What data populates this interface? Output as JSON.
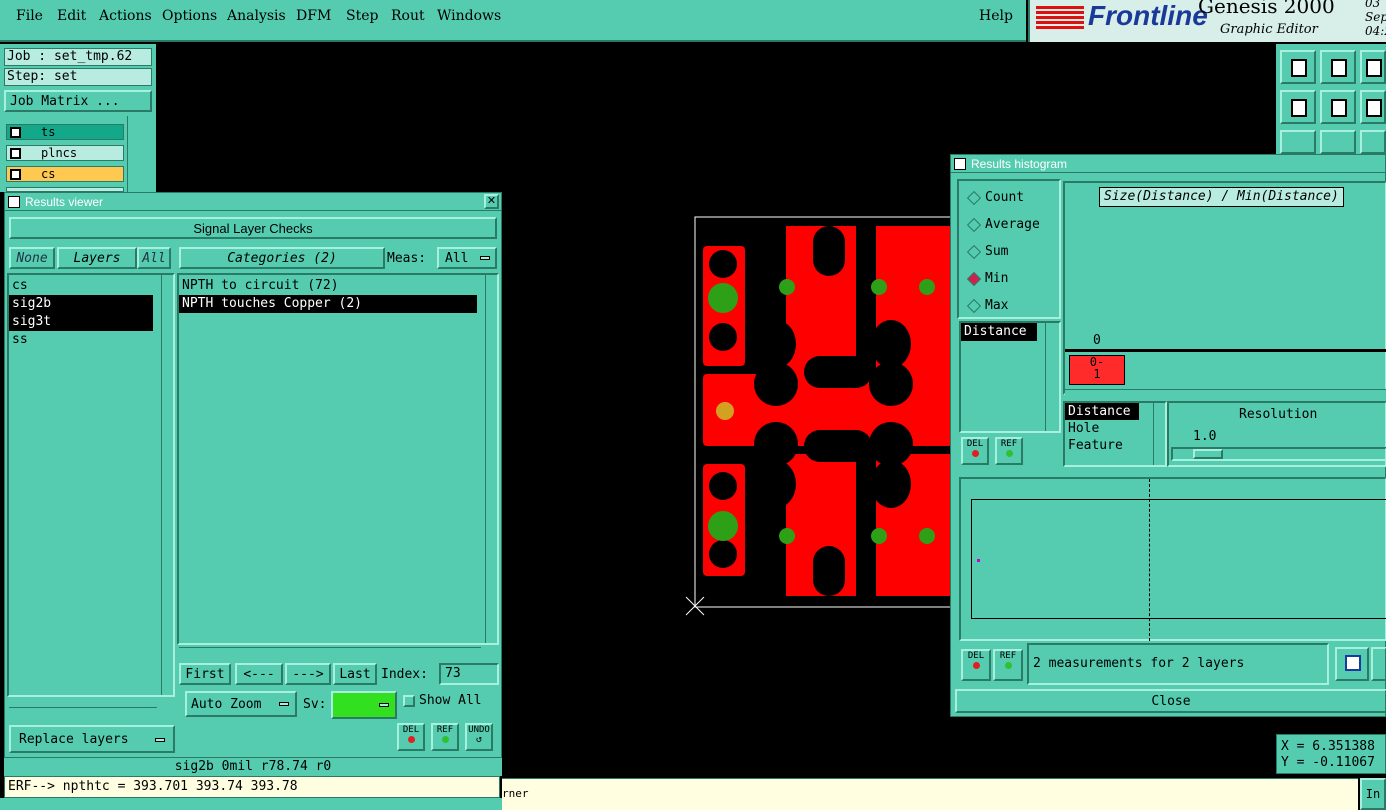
{
  "menu": {
    "items": [
      "File",
      "Edit",
      "Actions",
      "Options",
      "Analysis",
      "DFM",
      "Step",
      "Rout",
      "Windows"
    ],
    "help": "Help"
  },
  "brand": {
    "logo": "Frontline",
    "product": "Genesis 2000",
    "subtitle": "Graphic Editor",
    "date_fragment": "03 Sep",
    "time_fragment": "04:2"
  },
  "job": {
    "job_label": "Job : set_tmp.62",
    "step_label": "Step: set",
    "matrix_button": "Job Matrix ..."
  },
  "layers": [
    {
      "name": "ts",
      "color": "#13a88a"
    },
    {
      "name": "plncs",
      "color": "#b8ece0"
    },
    {
      "name": "cs",
      "color": "#ffc850"
    },
    {
      "name": "",
      "color": "#b8ece0"
    }
  ],
  "results_viewer": {
    "title": "Results viewer",
    "heading": "Signal Layer Checks",
    "none_button": "None",
    "layers_button": "Layers",
    "all_button": "All",
    "categories_button": "Categories (2)",
    "meas_label": "Meas:",
    "meas_value": "All",
    "layer_list": [
      {
        "name": "cs",
        "selected": false
      },
      {
        "name": "sig2b",
        "selected": true
      },
      {
        "name": "sig3t",
        "selected": true
      },
      {
        "name": "ss",
        "selected": false
      }
    ],
    "category_list": [
      {
        "name": "NPTH to circuit (72)",
        "selected": false
      },
      {
        "name": "NPTH touches Copper (2)",
        "selected": true
      }
    ],
    "nav": {
      "first": "First",
      "prev": "<---",
      "next": "--->",
      "last": "Last",
      "index_label": "Index:",
      "index_value": "73"
    },
    "auto_zoom": "Auto Zoom",
    "sv_label": "Sv:",
    "show_all": "Show All",
    "replace_layers": "Replace layers",
    "del": "DEL",
    "ref": "REF",
    "undo": "UNDO"
  },
  "status_line": "sig2b 0mil  r78.74  r0",
  "command_line": "ERF--> npthtc = 393.701 393.74 393.78",
  "message_bar": "rner",
  "histogram": {
    "title": "Results histogram",
    "modes": [
      {
        "label": "Count",
        "on": false
      },
      {
        "label": "Average",
        "on": false
      },
      {
        "label": "Sum",
        "on": false
      },
      {
        "label": "Min",
        "on": true
      },
      {
        "label": "Max",
        "on": false
      }
    ],
    "chart_title": "Size(Distance) / Min(Distance)",
    "axis_zero": "0",
    "bin_label_top": "0-",
    "bin_label_bottom": "1",
    "field_list_left": [
      "Distance"
    ],
    "field_list": [
      "Distance",
      "Hole",
      "Feature"
    ],
    "resolution_label": "Resolution",
    "resolution_value": "1.0",
    "summary": "2 measurements for 2 layers",
    "close": "Close",
    "del": "DEL",
    "ref": "REF"
  },
  "coords": {
    "x": "X = 6.351388",
    "y": "Y = -0.11067"
  },
  "right_edge_button": "In"
}
